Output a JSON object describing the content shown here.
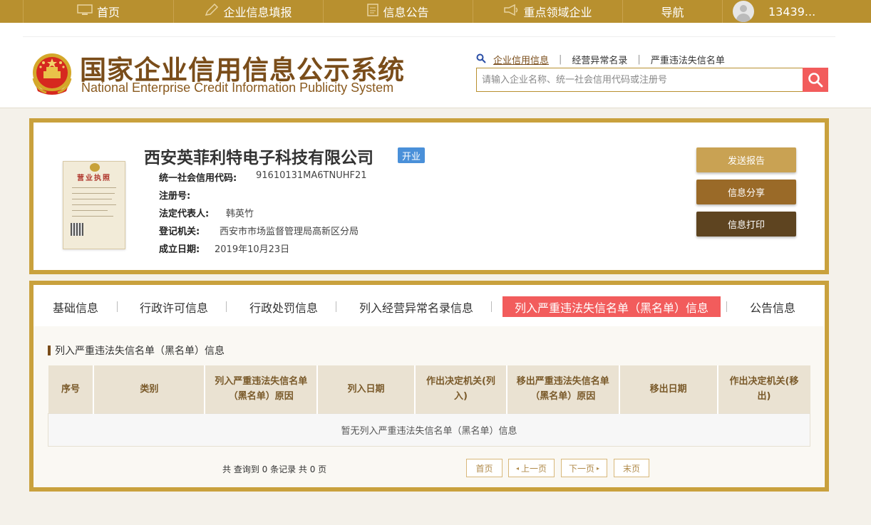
{
  "topnav": {
    "items": [
      {
        "label": "首页",
        "icon": "monitor-icon"
      },
      {
        "label": "企业信息填报",
        "icon": "edit-icon"
      },
      {
        "label": "信息公告",
        "icon": "document-icon"
      },
      {
        "label": "重点领域企业",
        "icon": "megaphone-icon"
      },
      {
        "label": "导航",
        "icon": ""
      }
    ],
    "user": "13439..."
  },
  "header": {
    "logo_cn": "国家企业信用信息公示系统",
    "logo_en": "National Enterprise Credit Information Publicity System",
    "search_links": [
      "企业信用信息",
      "经营异常名录",
      "严重违法失信名单"
    ],
    "search_placeholder": "请输入企业名称、统一社会信用代码或注册号"
  },
  "company": {
    "name": "西安英菲利特电子科技有限公司",
    "status": "开业",
    "license_title": "营业执照",
    "fields": [
      {
        "label": "统一社会信用代码:",
        "value": "91610131MA6TNUHF21"
      },
      {
        "label": "注册号:",
        "value": ""
      },
      {
        "label": "法定代表人:",
        "value": "韩英竹"
      },
      {
        "label": "登记机关:",
        "value": "西安市市场监督管理局高新区分局"
      },
      {
        "label": "成立日期:",
        "value": "2019年10月23日"
      }
    ]
  },
  "actions": {
    "send_report": "发送报告",
    "share": "信息分享",
    "print": "信息打印"
  },
  "tabs": [
    "基础信息",
    "行政许可信息",
    "行政处罚信息",
    "列入经营异常名录信息",
    "列入严重违法失信名单（黑名单）信息",
    "公告信息"
  ],
  "section": {
    "title": "列入严重违法失信名单（黑名单）信息",
    "columns": [
      "序号",
      "类别",
      "列入严重违法失信名单（黑名单）原因",
      "列入日期",
      "作出决定机关(列入)",
      "移出严重违法失信名单（黑名单）原因",
      "移出日期",
      "作出决定机关(移出)"
    ],
    "empty_text": "暂无列入严重违法失信名单（黑名单）信息"
  },
  "pagination": {
    "summary": "共 查询到 0 条记录 共 0 页",
    "first": "首页",
    "prev": "上一页",
    "next": "下一页",
    "last": "末页"
  },
  "colors": {
    "gold": "#b8902f",
    "brown": "#7a4d1a",
    "red": "#f25c5c",
    "blue": "#4a90d9",
    "btn_send": "#c9a253",
    "btn_share": "#9a6a28",
    "btn_print": "#5e4420"
  }
}
